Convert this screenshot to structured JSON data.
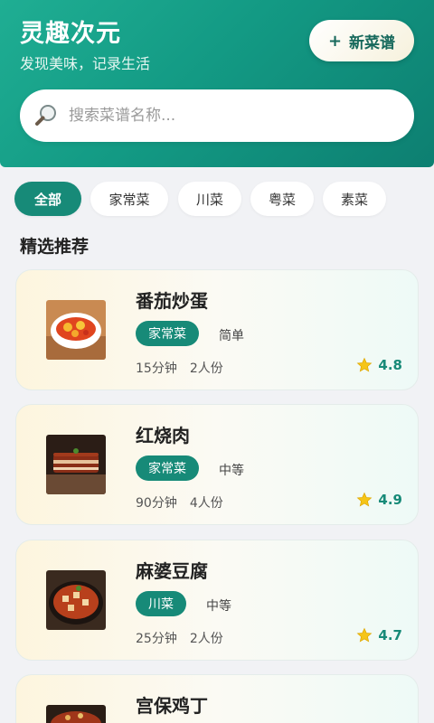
{
  "header": {
    "title": "灵趣次元",
    "subtitle": "发现美味，记录生活",
    "new_button_icon": "plus-icon",
    "new_button_label": "新菜谱"
  },
  "search": {
    "icon": "search-icon",
    "placeholder": "搜索菜谱名称..."
  },
  "categories": [
    "全部",
    "家常菜",
    "川菜",
    "粤菜",
    "素菜"
  ],
  "selected_category": "全部",
  "section_title": "精选推荐",
  "recipes": [
    {
      "name": "番茄炒蛋",
      "category": "家常菜",
      "difficulty": "简单",
      "time": "15分钟",
      "servings": "2人份",
      "rating": "4.8",
      "image": "tomato-egg-dish"
    },
    {
      "name": "红烧肉",
      "category": "家常菜",
      "difficulty": "中等",
      "time": "90分钟",
      "servings": "4人份",
      "rating": "4.9",
      "image": "braised-pork-dish"
    },
    {
      "name": "麻婆豆腐",
      "category": "川菜",
      "difficulty": "中等",
      "time": "25分钟",
      "servings": "2人份",
      "rating": "4.7",
      "image": "mapo-tofu-dish"
    },
    {
      "name": "宫保鸡丁",
      "category": "",
      "difficulty": "",
      "time": "",
      "servings": "",
      "rating": "",
      "image": "kung-pao-chicken-dish"
    }
  ],
  "colors": {
    "primary": "#178a78",
    "header_gradient_start": "#1fae93",
    "header_gradient_end": "#0d7f71",
    "rating_star": "#f5c518"
  }
}
